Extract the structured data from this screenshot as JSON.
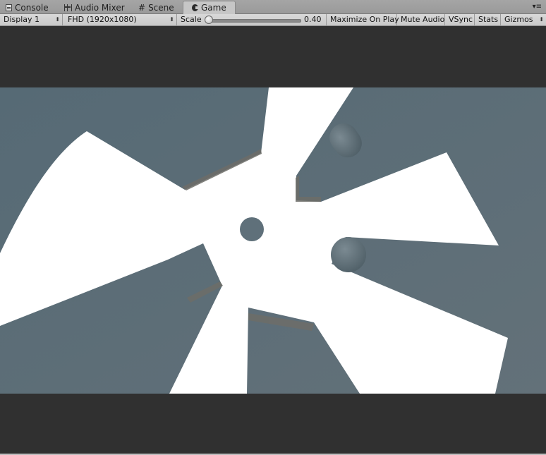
{
  "tabs": [
    {
      "label": "Console",
      "icon": "console-icon"
    },
    {
      "label": "Audio Mixer",
      "icon": "audio-mixer-icon"
    },
    {
      "label": "Scene",
      "icon": "scene-grid-icon"
    },
    {
      "label": "Game",
      "icon": "game-controller-icon",
      "active": true
    }
  ],
  "toolbar": {
    "display": "Display 1",
    "resolution": "FHD (1920x1080)",
    "scale_label": "Scale",
    "scale_value": "0.40",
    "maximize": "Maximize On Play",
    "mute": "Mute Audio",
    "vsync": "VSync",
    "stats": "Stats",
    "gizmos": "Gizmos"
  },
  "colors": {
    "sky": "#5f707a",
    "pinwheel": "#ffffff",
    "letterbox": "#303030"
  }
}
